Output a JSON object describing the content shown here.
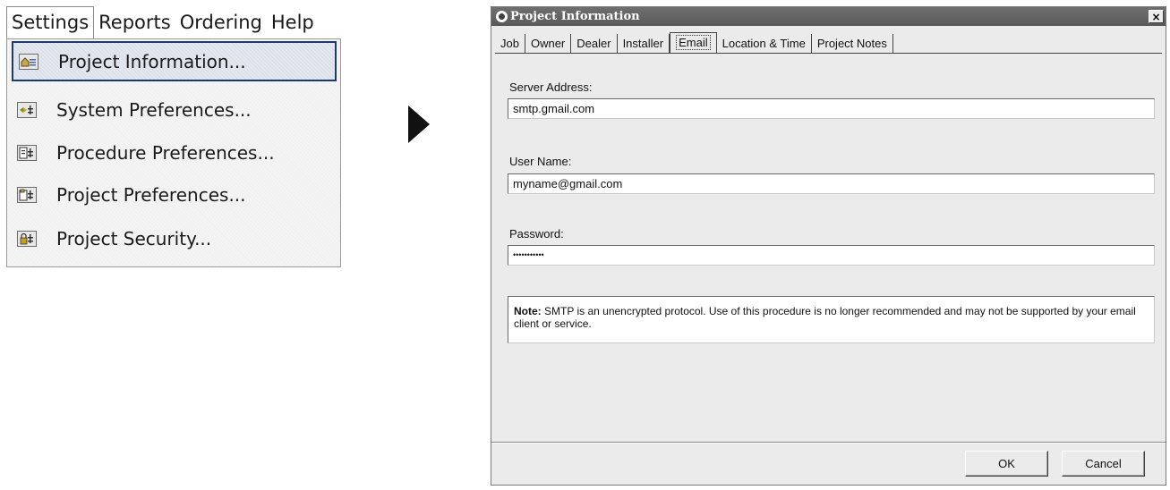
{
  "menubar": {
    "items": [
      "Settings",
      "Reports",
      "Ordering",
      "Help"
    ]
  },
  "settings_menu": {
    "items": [
      {
        "label": "Project Information...",
        "icon": "project-info-icon",
        "highlighted": true
      },
      {
        "label": "System Preferences...",
        "icon": "system-preferences-icon",
        "highlighted": false
      },
      {
        "label": "Procedure Preferences...",
        "icon": "procedure-preferences-icon",
        "highlighted": false
      },
      {
        "label": "Project Preferences...",
        "icon": "project-preferences-icon",
        "highlighted": false
      },
      {
        "label": "Project Security...",
        "icon": "lock-icon",
        "highlighted": false
      }
    ]
  },
  "dialog": {
    "title": "Project Information",
    "close_label": "×",
    "tabs": [
      "Job",
      "Owner",
      "Dealer",
      "Installer",
      "Email",
      "Location & Time",
      "Project Notes"
    ],
    "active_tab": "Email",
    "fields": {
      "server_label": "Server Address:",
      "server_value": "smtp.gmail.com",
      "username_label": "User Name:",
      "username_value": "myname@gmail.com",
      "password_label": "Password:",
      "password_value": "•••••••••••"
    },
    "note": {
      "bold": "Note:",
      "text": " SMTP is an unencrypted protocol. Use of this procedure is no longer recommended and may not be supported by your email client or service."
    },
    "buttons": {
      "ok": "OK",
      "cancel": "Cancel"
    }
  },
  "colors": {
    "highlight_border": "#1d3a6b",
    "titlebar": "#595959",
    "dialog_bg": "#ebebeb"
  }
}
